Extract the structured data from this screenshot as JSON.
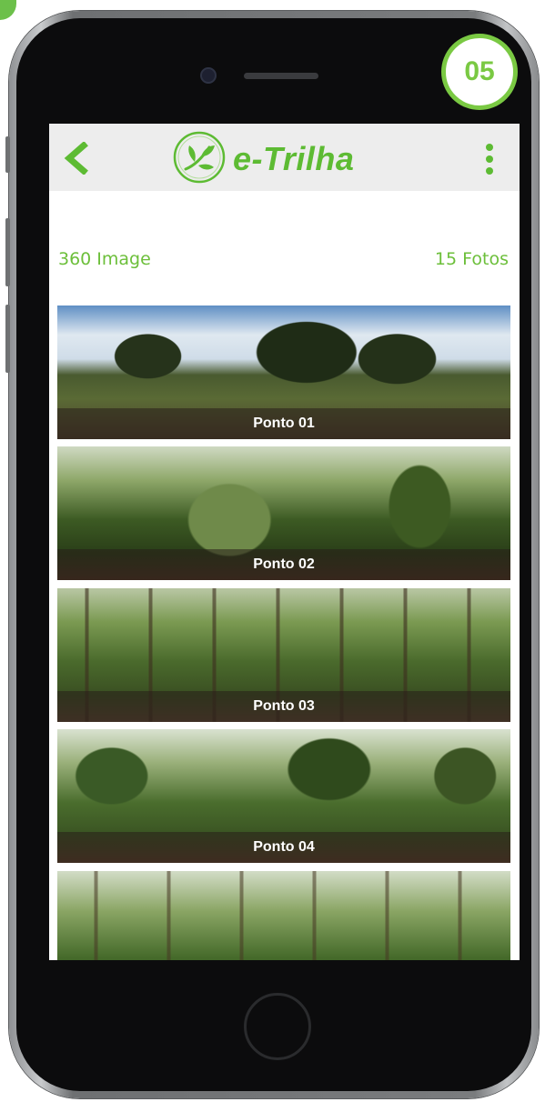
{
  "step_badge": "05",
  "header": {
    "logo_text": "e-Trilha",
    "back_icon": "chevron-left-icon",
    "menu_icon": "kebab-menu-icon",
    "accent_color": "#5dbb33"
  },
  "section": {
    "title": "360 Image",
    "count": "15 Fotos"
  },
  "photos": [
    {
      "label": "Ponto 01"
    },
    {
      "label": "Ponto 02"
    },
    {
      "label": "Ponto 03"
    },
    {
      "label": "Ponto 04"
    },
    {
      "label": ""
    }
  ]
}
